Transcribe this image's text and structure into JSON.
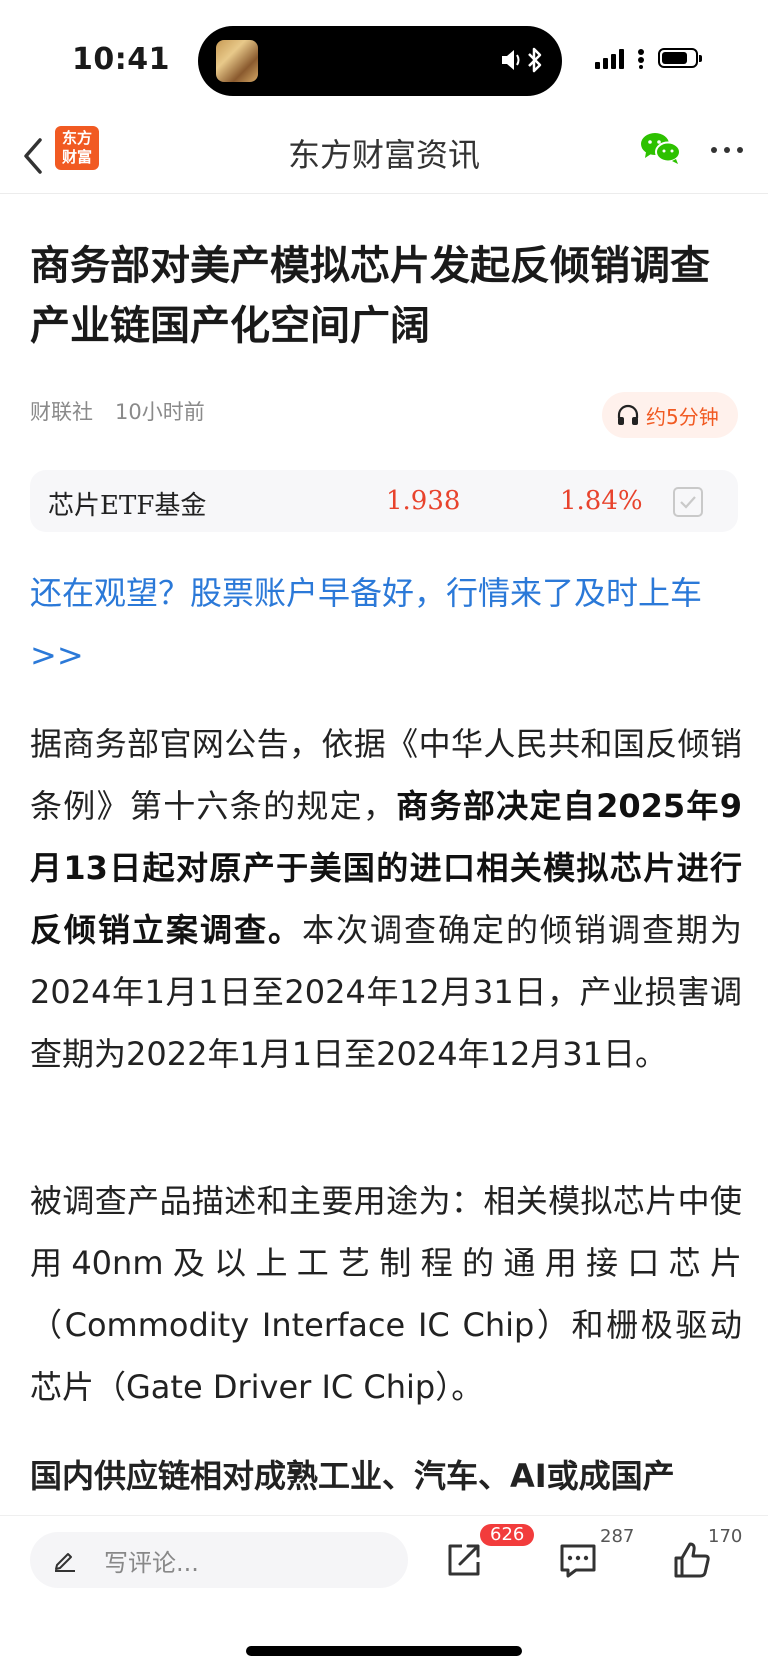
{
  "status_bar": {
    "time": "10:41"
  },
  "nav": {
    "title": "东方财富资讯",
    "logo_line1": "东方",
    "logo_line2": "财富"
  },
  "article": {
    "headline": "商务部对美产模拟芯片发起反倾销调查 产业链国产化空间广阔",
    "source": "财联社",
    "time_ago": "10小时前",
    "listen_label": "约5分钟"
  },
  "etf": {
    "name": "芯片ETF基金",
    "price": "1.938",
    "change": "1.84%"
  },
  "promo_text": "还在观望？股票账户早备好，行情来了及时上车>>",
  "paragraph1": {
    "part1": "据商务部官网公告，依据《中华人民共和国反倾销条例》第十六条的规定，",
    "bold": "商务部决定自2025年9月13日起对原产于美国的进口相关模拟芯片进行反倾销立案调查。",
    "part2": "本次调查确定的倾销调查期为2024年1月1日至2024年12月31日，产业损害调查期为2022年1月1日至2024年12月31日。"
  },
  "paragraph2": "被调查产品描述和主要用途为：相关模拟芯片中使用40nm及以上工艺制程的通用接口芯片（Commodity Interface IC Chip）和栅极驱动芯片（Gate Driver IC Chip）。",
  "paragraph3": "国内供应链相对成熟工业、汽车、AI或成国产",
  "bottom": {
    "comment_placeholder": "写评论...",
    "share_count": "626",
    "comment_count": "287",
    "like_count": "170"
  },
  "colors": {
    "accent": "#f15a22",
    "link": "#2b79d8",
    "price_up": "#e8432d",
    "badge": "#f23c3c"
  }
}
